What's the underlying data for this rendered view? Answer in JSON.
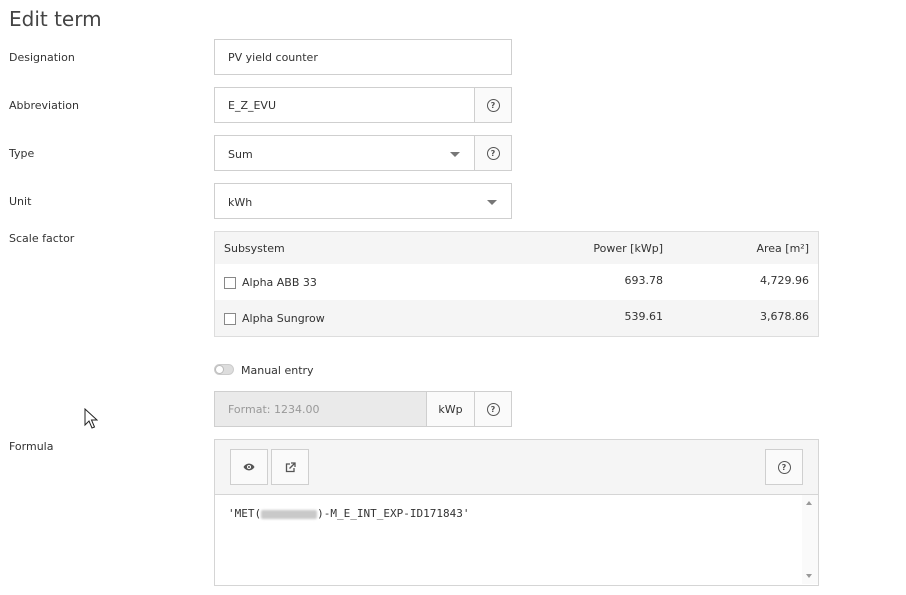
{
  "page": {
    "title": "Edit term"
  },
  "labels": {
    "designation": "Designation",
    "abbreviation": "Abbreviation",
    "type": "Type",
    "unit": "Unit",
    "scale_factor": "Scale factor",
    "formula": "Formula"
  },
  "fields": {
    "designation_value": "PV yield counter",
    "abbreviation_value": "E_Z_EVU",
    "type_value": "Sum",
    "unit_value": "kWh"
  },
  "subsystem_table": {
    "headers": {
      "subsystem": "Subsystem",
      "power": "Power [kWp]",
      "area": "Area [m²]"
    },
    "rows": [
      {
        "name": "Alpha ABB 33",
        "power": "693.78",
        "area": "4,729.96",
        "checked": false
      },
      {
        "name": "Alpha Sungrow",
        "power": "539.61",
        "area": "3,678.86",
        "checked": false
      }
    ]
  },
  "manual_entry": {
    "label": "Manual entry",
    "enabled": false,
    "placeholder": "Format: 1234.00",
    "unit": "kWp"
  },
  "formula": {
    "prefix": "'MET(",
    "suffix": ")-M_E_INT_EXP-ID171843'"
  },
  "icons": {
    "help": "question-circle-icon",
    "preview": "eye-icon",
    "open_external": "external-link-icon",
    "dropdown": "caret-down-icon"
  }
}
